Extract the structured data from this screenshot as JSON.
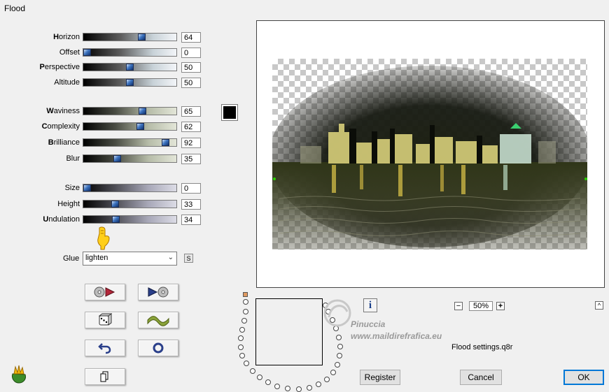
{
  "window": {
    "title": "Flood"
  },
  "sliders": [
    {
      "pre": "H",
      "post": "orizon",
      "value": "64",
      "level": 0.64,
      "grad": "g1"
    },
    {
      "pre": "",
      "post": "Offset",
      "value": "0",
      "level": 0.0,
      "grad": "g1"
    },
    {
      "pre": "P",
      "post": "erspective",
      "value": "50",
      "level": 0.5,
      "grad": "g1"
    },
    {
      "pre": "",
      "post": "Altitude",
      "value": "50",
      "level": 0.5,
      "grad": "g1"
    },
    {
      "pre": "W",
      "post": "aviness",
      "value": "65",
      "level": 0.65,
      "grad": "g2"
    },
    {
      "pre": "C",
      "post": "omplexity",
      "value": "62",
      "level": 0.62,
      "grad": "g2"
    },
    {
      "pre": "B",
      "post": "rilliance",
      "value": "92",
      "level": 0.92,
      "grad": "g2"
    },
    {
      "pre": "",
      "post": "Blur",
      "value": "35",
      "level": 0.35,
      "grad": "g2"
    },
    {
      "pre": "",
      "post": "Size",
      "value": "0",
      "level": 0.0,
      "grad": "g3"
    },
    {
      "pre": "",
      "post": "Height",
      "value": "33",
      "level": 0.33,
      "grad": "g3"
    },
    {
      "pre": "U",
      "post": "ndulation",
      "value": "34",
      "level": 0.34,
      "grad": "g3"
    }
  ],
  "glue": {
    "label": "Glue",
    "value": "lighten",
    "s_button": "S"
  },
  "colors": {
    "swatch": "#000000",
    "ok_border": "#0078d7"
  },
  "tool_buttons": [
    "load-preset-icon",
    "save-preset-icon",
    "random-dice-icon",
    "wave-icon",
    "undo-icon",
    "reset-icon",
    "copy-icon"
  ],
  "zoom": {
    "value": "50%",
    "minus": "−",
    "plus": "+"
  },
  "info_button": "i",
  "collapse_button": "^",
  "settings_file": "Flood settings.q8r",
  "watermark": {
    "line1": "Pinuccia",
    "line2": "www.maildirefrafica.eu"
  },
  "buttons": {
    "register": "Register",
    "cancel": "Cancel",
    "ok": "OK"
  }
}
